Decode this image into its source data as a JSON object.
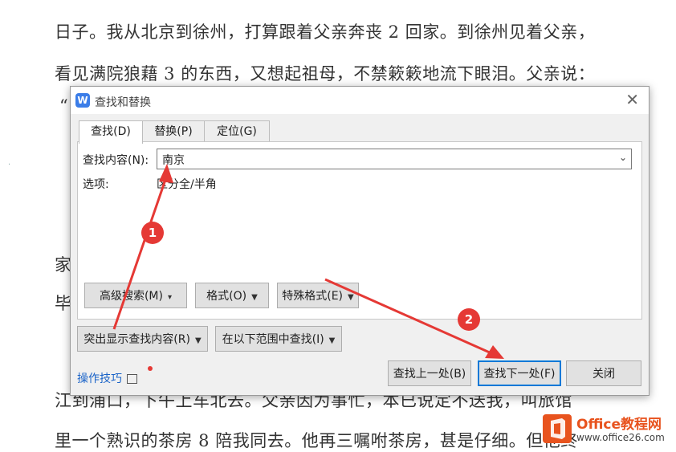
{
  "document": {
    "lines": [
      "日子。我从北京到徐州，打算跟着父亲奔丧 2 回家。到徐州见着父亲，",
      "看见满院狼藉 3 的东西，又想起祖母，不禁簌簌地流下眼泪。父亲说：",
      "“",
      "家",
      "毕",
      "江到浦口，下午上车北去。父亲因为事忙，本已说定不送我，叫旅馆",
      "里一个熟识的茶房 8 陪我同去。他再三嘱咐茶房，甚是仔细。但他终"
    ]
  },
  "dialog": {
    "title": "查找和替换",
    "app_icon": "W",
    "close": "✕",
    "tabs": [
      {
        "label": "查找(D)"
      },
      {
        "label": "替换(P)"
      },
      {
        "label": "定位(G)"
      }
    ],
    "find_label": "查找内容(N):",
    "find_value": "南京",
    "options_label": "选项:",
    "options_value": "区分全/半角",
    "buttons": {
      "advanced": "高级搜索(M)",
      "format": "格式(O)",
      "special": "特殊格式(E)",
      "highlight": "突出显示查找内容(R)",
      "scope": "在以下范围中查找(I)",
      "prev": "查找上一处(B)",
      "next": "查找下一处(F)",
      "close": "关闭"
    },
    "tips": "操作技巧"
  },
  "annotations": {
    "badge1": "1",
    "badge2": "2",
    "arrow_color": "#e53935"
  },
  "watermark": {
    "brand": "Office教程网",
    "url": "www.office26.com"
  },
  "colors": {
    "accent": "#0078d7",
    "annotation": "#e53935",
    "brand": "#e8531e"
  }
}
